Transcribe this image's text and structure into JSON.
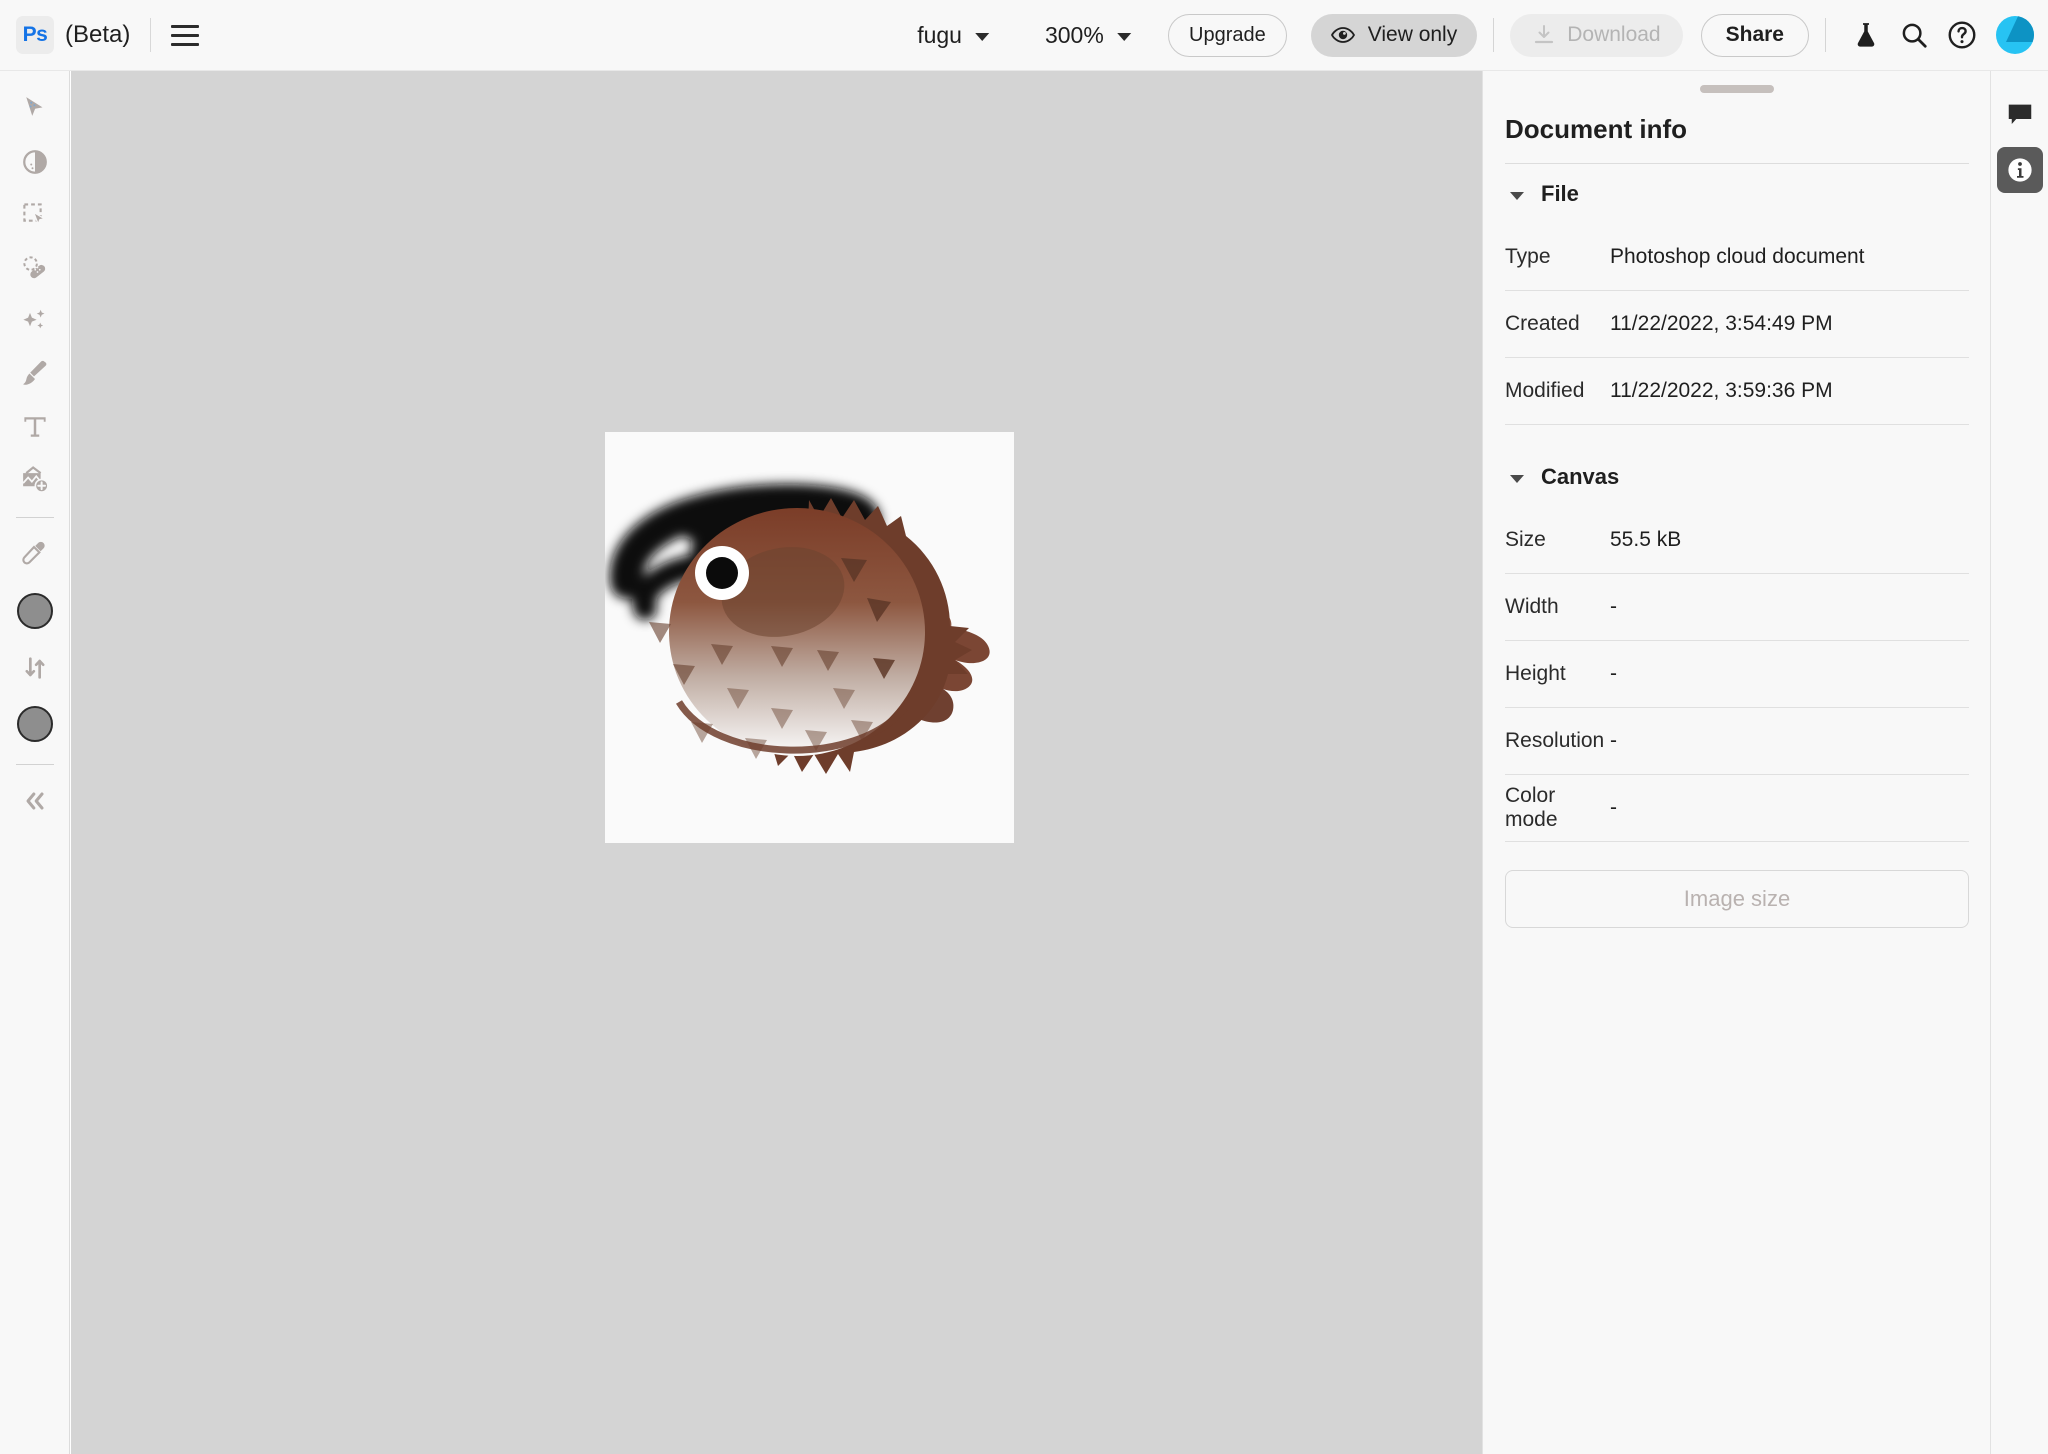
{
  "app": {
    "logo_text": "Ps",
    "beta_label": "(Beta)",
    "menu_icon": "hamburger-menu-icon"
  },
  "topbar": {
    "document_name": "fugu",
    "zoom_level": "300%",
    "upgrade_label": "Upgrade",
    "view_only_label": "View only",
    "download_label": "Download",
    "share_label": "Share",
    "icons": {
      "beta_flask": "flask-icon",
      "search": "search-icon",
      "help": "help-icon",
      "avatar": "user-avatar"
    }
  },
  "toolbar": {
    "items": [
      {
        "name": "move-tool",
        "icon": "cursor-arrow-icon"
      },
      {
        "name": "adjustment-tool",
        "icon": "half-circle-contrast-icon"
      },
      {
        "name": "object-selection-tool",
        "icon": "dashed-marquee-cursor-icon"
      },
      {
        "name": "spot-healing-brush-tool",
        "icon": "bandage-icon"
      },
      {
        "name": "remove-tool",
        "icon": "sparkles-icon"
      },
      {
        "name": "brush-tool",
        "icon": "paintbrush-icon"
      },
      {
        "name": "type-tool",
        "icon": "text-t-icon"
      },
      {
        "name": "place-image-tool",
        "icon": "image-plus-icon"
      },
      {
        "name": "eyedropper-tool",
        "icon": "eyedropper-icon"
      }
    ],
    "foreground_color": "#8e8e8e",
    "background_color": "#8e8e8e",
    "swap_icon": "swap-colors-arrows-icon",
    "collapse_icon": "double-chevron-left-icon"
  },
  "canvas": {
    "artwork_alt": "pufferfish-illustration-with-black-brush-scribble"
  },
  "panel": {
    "title": "Document info",
    "sections": [
      {
        "label": "File",
        "rows": [
          {
            "key": "Type",
            "value": "Photoshop cloud document"
          },
          {
            "key": "Created",
            "value": "11/22/2022, 3:54:49 PM"
          },
          {
            "key": "Modified",
            "value": "11/22/2022, 3:59:36 PM"
          }
        ]
      },
      {
        "label": "Canvas",
        "rows": [
          {
            "key": "Size",
            "value": "55.5 kB"
          },
          {
            "key": "Width",
            "value": "-"
          },
          {
            "key": "Height",
            "value": "-"
          },
          {
            "key": "Resolution",
            "value": "-"
          },
          {
            "key": "Color mode",
            "value": "-"
          }
        ]
      }
    ],
    "image_size_button": "Image size"
  },
  "rightrail": {
    "items": [
      {
        "name": "comments-icon",
        "active": false
      },
      {
        "name": "document-info-icon",
        "active": true
      }
    ]
  },
  "colors": {
    "accent": "#1473e6",
    "canvas_bg": "#d4d4d4",
    "panel_bg": "#f8f8f8",
    "avatar_cyan": "#27c3f3"
  }
}
